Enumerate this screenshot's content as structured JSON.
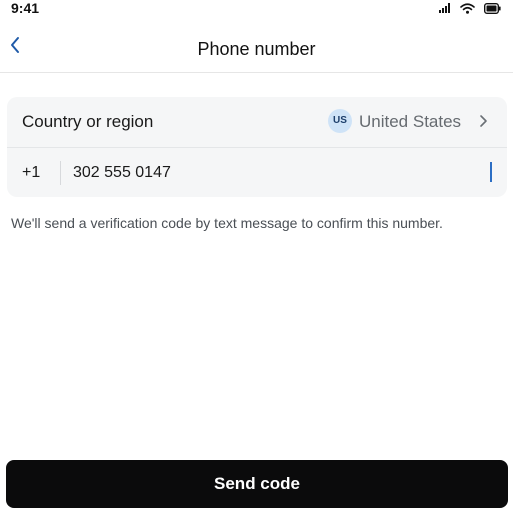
{
  "status_bar": {
    "time": "9:41",
    "icons": [
      "signal-icon",
      "wifi-icon",
      "battery-icon"
    ]
  },
  "header": {
    "title": "Phone number",
    "back_icon": "chevron-left-icon"
  },
  "form": {
    "country_label": "Country or region",
    "country_code_badge": "US",
    "country_value": "United States",
    "country_chevron_icon": "chevron-right-icon",
    "dial_code": "+1",
    "phone_value": "302 555 0147"
  },
  "helper_text": "We'll send a verification code by text message to confirm this number.",
  "send_button_label": "Send code",
  "colors": {
    "background": "#ffffff",
    "card": "#f5f6f7",
    "button": "#0b0b0c",
    "badge": "#cfe3f7",
    "cursor": "#2c6ec4"
  }
}
